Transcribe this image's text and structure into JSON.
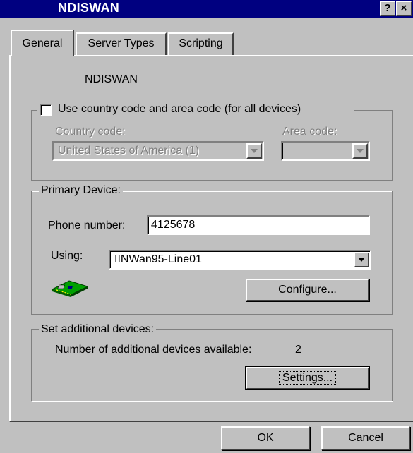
{
  "window": {
    "title": "NDISWAN",
    "help_button": "?",
    "close_button": "×"
  },
  "tabs": [
    {
      "label": "General",
      "active": true
    },
    {
      "label": "Server Types",
      "active": false
    },
    {
      "label": "Scripting",
      "active": false
    }
  ],
  "general": {
    "connection_name": "NDISWAN",
    "country_group": {
      "checkbox_label": "Use country code and area code (for all devices)",
      "checked": false,
      "country_label": "Country code:",
      "country_value": "United States of America (1)",
      "area_label": "Area code:",
      "area_value": ""
    },
    "primary_device": {
      "legend": "Primary Device:",
      "phone_label": "Phone number:",
      "phone_value": "4125678",
      "using_label": "Using:",
      "using_value": "IINWan95-Line01",
      "device_icon": "network-card-icon",
      "configure_label": "Configure..."
    },
    "additional": {
      "legend": "Set additional devices:",
      "count_text": "Number of additional devices available:",
      "count_value": "2",
      "settings_label": "Settings..."
    }
  },
  "footer": {
    "ok_label": "OK",
    "cancel_label": "Cancel"
  }
}
